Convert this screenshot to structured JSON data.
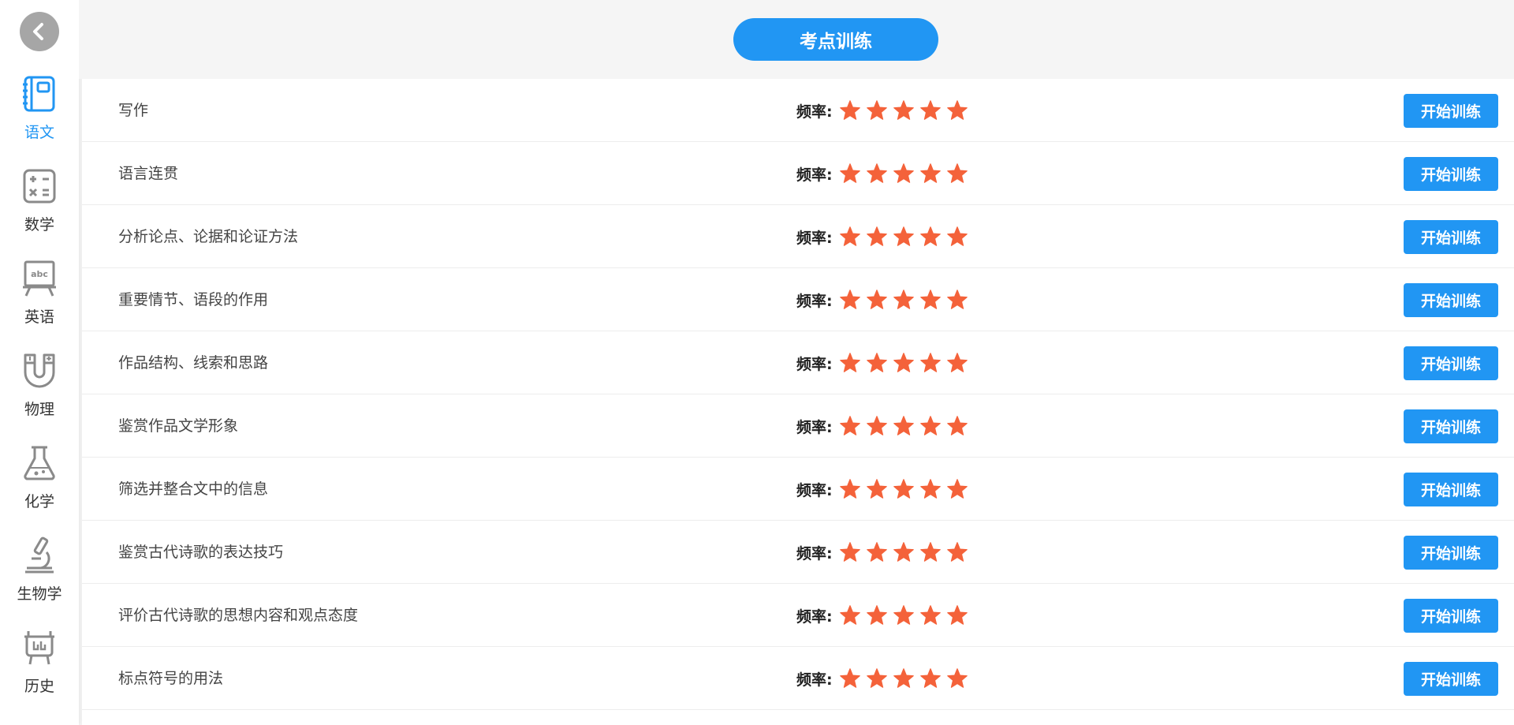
{
  "header": {
    "title": "考点训练"
  },
  "colors": {
    "accent": "#2196f3",
    "star": "#f4623a",
    "back_button": "#a6a6a6",
    "inactive_icon": "#8a8a8a"
  },
  "sidebar": {
    "back_icon": "chevron-left-icon",
    "subjects": [
      {
        "label": "语文",
        "icon": "notebook-icon",
        "active": true
      },
      {
        "label": "数学",
        "icon": "calculator-icon",
        "active": false
      },
      {
        "label": "英语",
        "icon": "abc-board-icon",
        "active": false
      },
      {
        "label": "物理",
        "icon": "magnet-icon",
        "active": false
      },
      {
        "label": "化学",
        "icon": "flask-icon",
        "active": false
      },
      {
        "label": "生物学",
        "icon": "microscope-icon",
        "active": false
      },
      {
        "label": "历史",
        "icon": "bronze-vessel-icon",
        "active": false
      }
    ]
  },
  "list": {
    "frequency_label": "频率:",
    "button_label": "开始训练",
    "items": [
      {
        "title": "写作",
        "rating": 5
      },
      {
        "title": "语言连贯",
        "rating": 5
      },
      {
        "title": "分析论点、论据和论证方法",
        "rating": 5
      },
      {
        "title": "重要情节、语段的作用",
        "rating": 5
      },
      {
        "title": "作品结构、线索和思路",
        "rating": 5
      },
      {
        "title": "鉴赏作品文学形象",
        "rating": 5
      },
      {
        "title": "筛选并整合文中的信息",
        "rating": 5
      },
      {
        "title": "鉴赏古代诗歌的表达技巧",
        "rating": 5
      },
      {
        "title": "评价古代诗歌的思想内容和观点态度",
        "rating": 5
      },
      {
        "title": "标点符号的用法",
        "rating": 5
      }
    ]
  }
}
